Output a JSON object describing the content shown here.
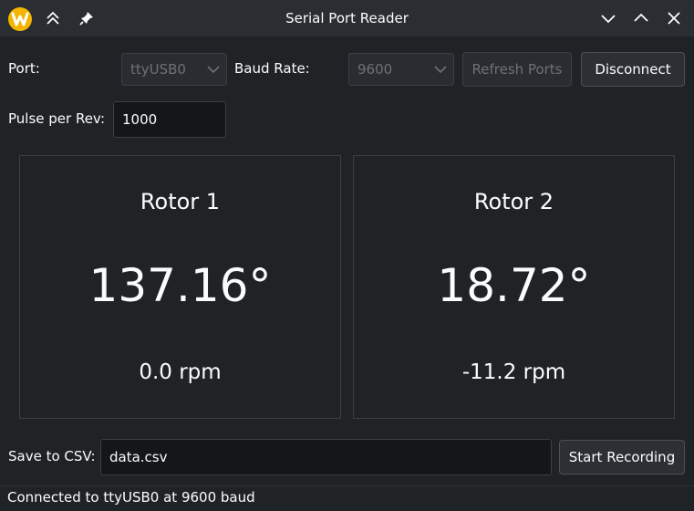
{
  "window": {
    "title": "Serial Port Reader",
    "icons": {
      "app": "app-logo-icon",
      "keep_above": "double-chevron-up-icon",
      "pin": "pin-icon",
      "minimize": "chevron-down-icon",
      "maximize": "chevron-up-icon",
      "close": "close-icon"
    }
  },
  "controls": {
    "port_label": "Port:",
    "port_value": "ttyUSB0",
    "baud_label": "Baud Rate:",
    "baud_value": "9600",
    "refresh_label": "Refresh Ports",
    "disconnect_label": "Disconnect",
    "ppr_label": "Pulse per Rev:",
    "ppr_value": "1000"
  },
  "rotors": [
    {
      "name": "Rotor 1",
      "angle": "137.16°",
      "rpm": "0.0 rpm"
    },
    {
      "name": "Rotor 2",
      "angle": "18.72°",
      "rpm": "-11.2 rpm"
    }
  ],
  "recording": {
    "csv_label": "Save to CSV:",
    "csv_value": "data.csv",
    "start_label": "Start Recording"
  },
  "status": {
    "text": "Connected to ttyUSB0 at 9600 baud"
  },
  "colors": {
    "background": "#202326",
    "titlebar": "#2a2e32",
    "text": "#fcfcfc",
    "disabled_text": "#6e7175",
    "app_icon": "#f4b400"
  }
}
